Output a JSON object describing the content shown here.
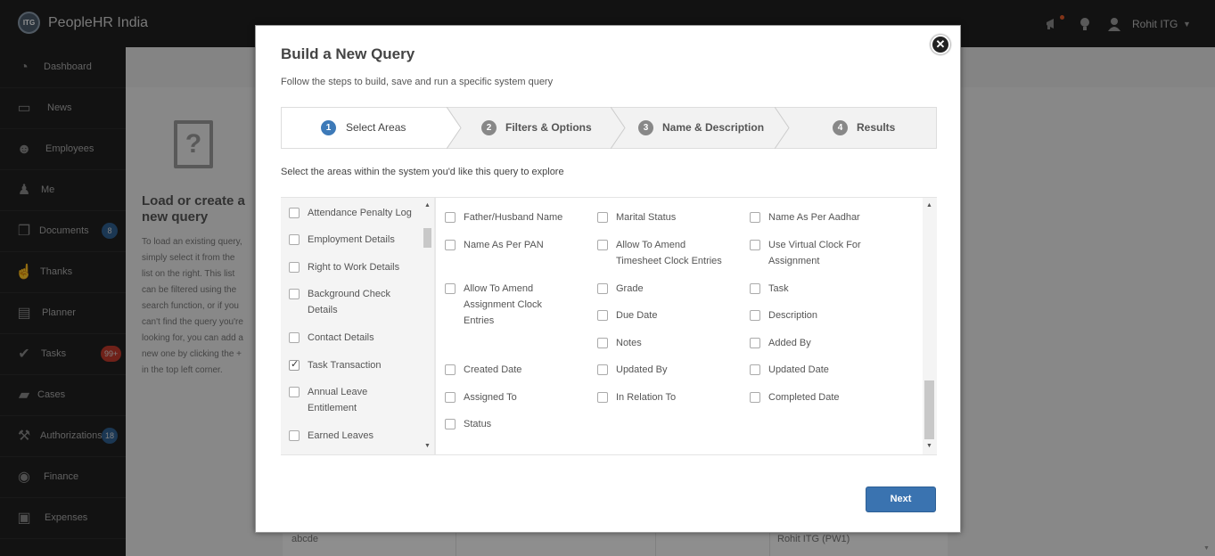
{
  "app": {
    "logo_text": "ITG",
    "title": "PeopleHR India",
    "user_name": "Rohit ITG"
  },
  "sidebar": {
    "items": [
      {
        "label": "Dashboard",
        "icon": "dashboard-icon"
      },
      {
        "label": "News",
        "icon": "tv-icon"
      },
      {
        "label": "Employees",
        "icon": "people-icon"
      },
      {
        "label": "Me",
        "icon": "user-icon"
      },
      {
        "label": "Documents",
        "icon": "documents-icon",
        "badge": "8"
      },
      {
        "label": "Thanks",
        "icon": "thumbs-up-icon"
      },
      {
        "label": "Planner",
        "icon": "planner-icon"
      },
      {
        "label": "Tasks",
        "icon": "check-icon",
        "badge": "99+"
      },
      {
        "label": "Cases",
        "icon": "briefcase-icon"
      },
      {
        "label": "Authorizations",
        "icon": "gavel-icon",
        "badge": "18"
      },
      {
        "label": "Finance",
        "icon": "coins-icon"
      },
      {
        "label": "Expenses",
        "icon": "wallet-icon"
      }
    ]
  },
  "background": {
    "panel_title": "Load or create a new query",
    "panel_description": "To load an existing query, simply select it from the list on the right. This list can be filtered using the search function, or if you can't find the query you're looking for, you can add a new one by clicking the + in the top left corner.",
    "row_name": "abcde",
    "row_owner": "Rohit ITG (PW1)"
  },
  "modal": {
    "title": "Build a New Query",
    "subtitle": "Follow the steps to build, save and run a specific system query",
    "close_symbol": "✕",
    "steps": [
      {
        "number": "1",
        "label": "Select Areas",
        "active": true
      },
      {
        "number": "2",
        "label": "Filters & Options",
        "active": false
      },
      {
        "number": "3",
        "label": "Name & Description",
        "active": false
      },
      {
        "number": "4",
        "label": "Results",
        "active": false
      }
    ],
    "instruction": "Select the areas within the system you'd like this query to explore",
    "areas": [
      {
        "label": "Attendance Penalty Log",
        "checked": false
      },
      {
        "label": "Employment Details",
        "checked": false
      },
      {
        "label": "Right to Work Details",
        "checked": false
      },
      {
        "label": "Background Check Details",
        "checked": false
      },
      {
        "label": "Contact Details",
        "checked": false
      },
      {
        "label": "Task Transaction",
        "checked": true
      },
      {
        "label": "Annual Leave Entitlement",
        "checked": false
      },
      {
        "label": "Earned Leaves",
        "checked": false
      }
    ],
    "fields": [
      {
        "label": "Father/Husband Name",
        "checked": false
      },
      {
        "label": "Marital Status",
        "checked": false
      },
      {
        "label": "Name As Per Aadhar",
        "checked": false
      },
      {
        "label": "Name As Per PAN",
        "checked": false
      },
      {
        "label": "Allow To Amend Timesheet Clock Entries",
        "checked": false
      },
      {
        "label": "Use Virtual Clock For Assignment",
        "checked": false
      },
      {
        "label": "Allow To Amend Assignment Clock Entries",
        "checked": false
      },
      {
        "label": "Grade",
        "checked": false
      },
      {
        "label": "Task",
        "checked": false
      },
      {
        "label": "Due Date",
        "checked": false
      },
      {
        "label": "Description",
        "checked": false
      },
      {
        "label": "Notes",
        "checked": false
      },
      {
        "label": "Added By",
        "checked": false
      },
      {
        "label": "Created Date",
        "checked": false
      },
      {
        "label": "Updated By",
        "checked": false
      },
      {
        "label": "Updated Date",
        "checked": false
      },
      {
        "label": "Assigned To",
        "checked": false
      },
      {
        "label": "In Relation To",
        "checked": false
      },
      {
        "label": "Completed Date",
        "checked": false
      },
      {
        "label": "Status",
        "checked": false
      }
    ],
    "next_label": "Next"
  },
  "colors": {
    "accent": "#3a73b0",
    "sidebar_bg": "#1f1f1f",
    "badge_blue": "#2f5f8f",
    "badge_red": "#c0392b"
  }
}
